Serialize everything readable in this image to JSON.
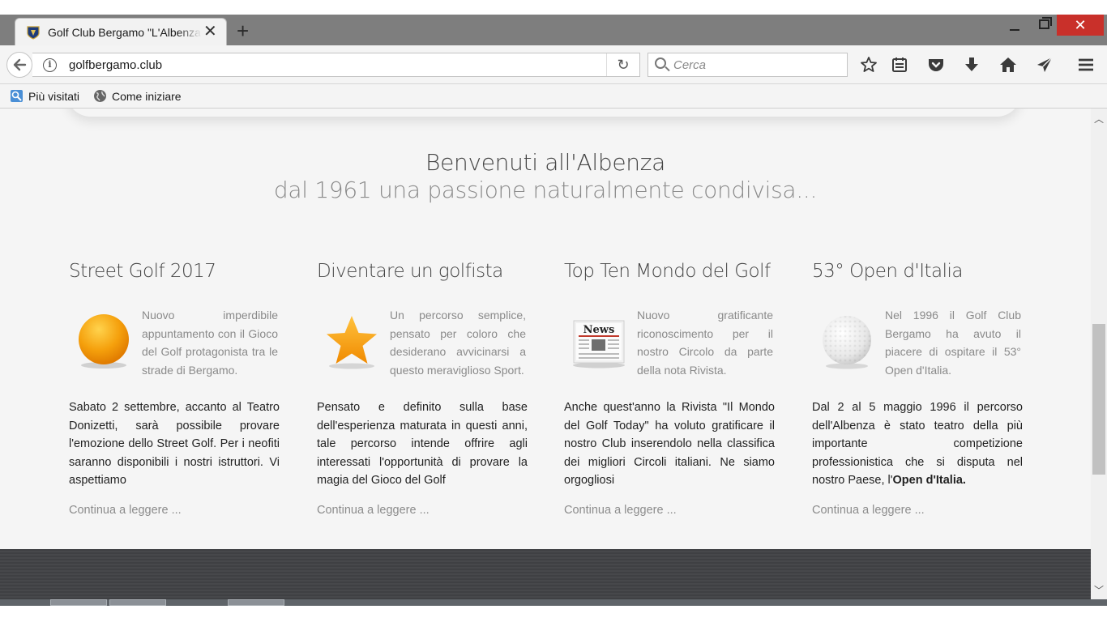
{
  "browser": {
    "tab_title": "Golf Club Bergamo \"L'Albenza\"",
    "tab_close": "✕",
    "new_tab": "+",
    "close_window": "✕",
    "url": "golfbergamo.club",
    "reload": "↻",
    "search_placeholder": "Cerca",
    "bookmarks": [
      {
        "label": "Più visitati"
      },
      {
        "label": "Come iniziare"
      }
    ],
    "toolbar_icons": [
      "star-icon",
      "reader-icon",
      "pocket-icon",
      "download-icon",
      "home-icon",
      "send-icon",
      "menu-icon"
    ]
  },
  "page": {
    "hero_title": "Benvenuti all'Albenza",
    "hero_subtitle": "dal 1961 una passione naturalmente condivisa...",
    "columns": [
      {
        "title": "Street Golf 2017",
        "image": "orange-ball-icon",
        "intro": "Nuovo imperdibile appuntamento con il Gioco del Golf protagonista tra le strade di Bergamo.",
        "body": "Sabato 2 settembre, accanto al Teatro Donizetti, sarà possibile provare l'emozione dello Street Golf. Per i neofiti saranno disponibili i nostri istruttori. Vi aspettiamo",
        "more": "Continua a leggere ..."
      },
      {
        "title": "Diventare un golfista",
        "image": "star-icon",
        "intro": "Un percorso semplice, pensato per coloro che desiderano avvicinarsi a questo meraviglioso Sport.",
        "body": "Pensato e definito sulla base dell'esperienza maturata in questi anni, tale percorso intende offrire agli interessati l'opportunità di provare la magia del Gioco del Golf",
        "more": "Continua a leggere ..."
      },
      {
        "title": "Top Ten Mondo del Golf",
        "image": "newspaper-icon",
        "image_text": "News",
        "intro": "Nuovo gratificante riconoscimento per il nostro Circolo da parte della nota Rivista.",
        "body": "Anche quest'anno la Rivista \"Il Mondo del Golf Today\" ha voluto gratificare il nostro Club inserendolo nella classifica dei migliori Circoli italiani. Ne siamo orgogliosi",
        "more": "Continua a leggere ..."
      },
      {
        "title": "53° Open d'Italia",
        "image": "golf-ball-icon",
        "intro": "Nel 1996 il Golf Club Bergamo ha avuto il piacere di ospitare il 53° Open d'Italia.",
        "body": "Dal 2 al 5 maggio 1996 il percorso dell'Albenza è stato teatro della più importante competizione professionistica che si disputa nel nostro Paese, l'",
        "body_bold": "Open d'Italia.",
        "more": "Continua a leggere ..."
      }
    ]
  },
  "colors": {
    "accent_orange": "#f39c12",
    "titlebar": "#7e7e7e",
    "close_red": "#c9302a",
    "footer": "#434447"
  }
}
